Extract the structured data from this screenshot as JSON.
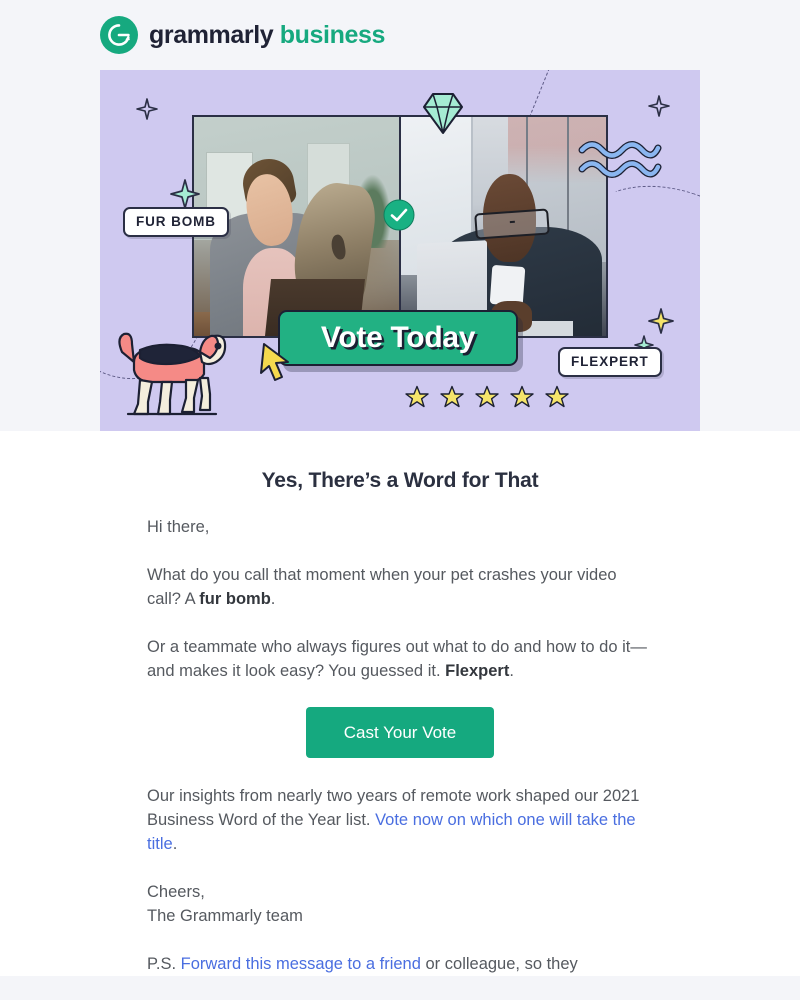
{
  "page": {
    "background_color": "#f4f5f9",
    "body_background": "#ffffff"
  },
  "header": {
    "logo_icon": "grammarly-g-logo-icon",
    "brand_name": "grammarly",
    "brand_suffix": "business",
    "brand_color": "#1f2235",
    "accent_color": "#16a97f"
  },
  "hero": {
    "background_color": "#cfc9f0",
    "labels": {
      "fur_bomb": "FUR BOMB",
      "flexpert": "FLEXPERT"
    },
    "badge": {
      "text": "Vote Today",
      "background_color": "#22b183",
      "text_color": "#ffffff"
    },
    "decorations": {
      "diamond_icon": "diamond-icon",
      "waves_icon": "waves-icon",
      "check_badge_icon": "check-circle-icon",
      "cursor_icon": "cursor-arrow-icon",
      "dog_icon": "beagle-dog-icon",
      "sparkle_icon": "sparkle-icon",
      "star_icon": "star-icon",
      "star_count": 5,
      "star_color": "#f5e46a",
      "sparkle_yellow": "#f5e46a",
      "sparkle_mint": "#a5ecd3"
    },
    "photos": {
      "left_alt": "woman laughing with dog during video call",
      "right_alt": "man with glasses working at laptop"
    }
  },
  "main": {
    "headline": "Yes, There’s a Word for That",
    "greeting": "Hi there,",
    "paragraph_1": {
      "before": "What do you call that moment when your pet crashes your video call? A ",
      "bold": "fur bomb",
      "after": "."
    },
    "paragraph_2": {
      "before": "Or a teammate who always figures out what to do and how to do it—and makes it look easy? You guessed it. ",
      "bold": "Flexpert",
      "after": "."
    },
    "cta": {
      "label": "Cast Your Vote",
      "background_color": "#15a97f"
    },
    "paragraph_3": {
      "before": "Our insights from nearly two years of remote work shaped our 2021 Business Word of the Year list. ",
      "link": "Vote now on which one will take the title",
      "after": "."
    },
    "signoff_line_1": "Cheers,",
    "signoff_line_2": "The Grammarly team",
    "postscript": {
      "before": "P.S. ",
      "link": "Forward this message to a friend",
      "after": " or colleague, so they"
    },
    "link_color": "#4a6ee0"
  }
}
